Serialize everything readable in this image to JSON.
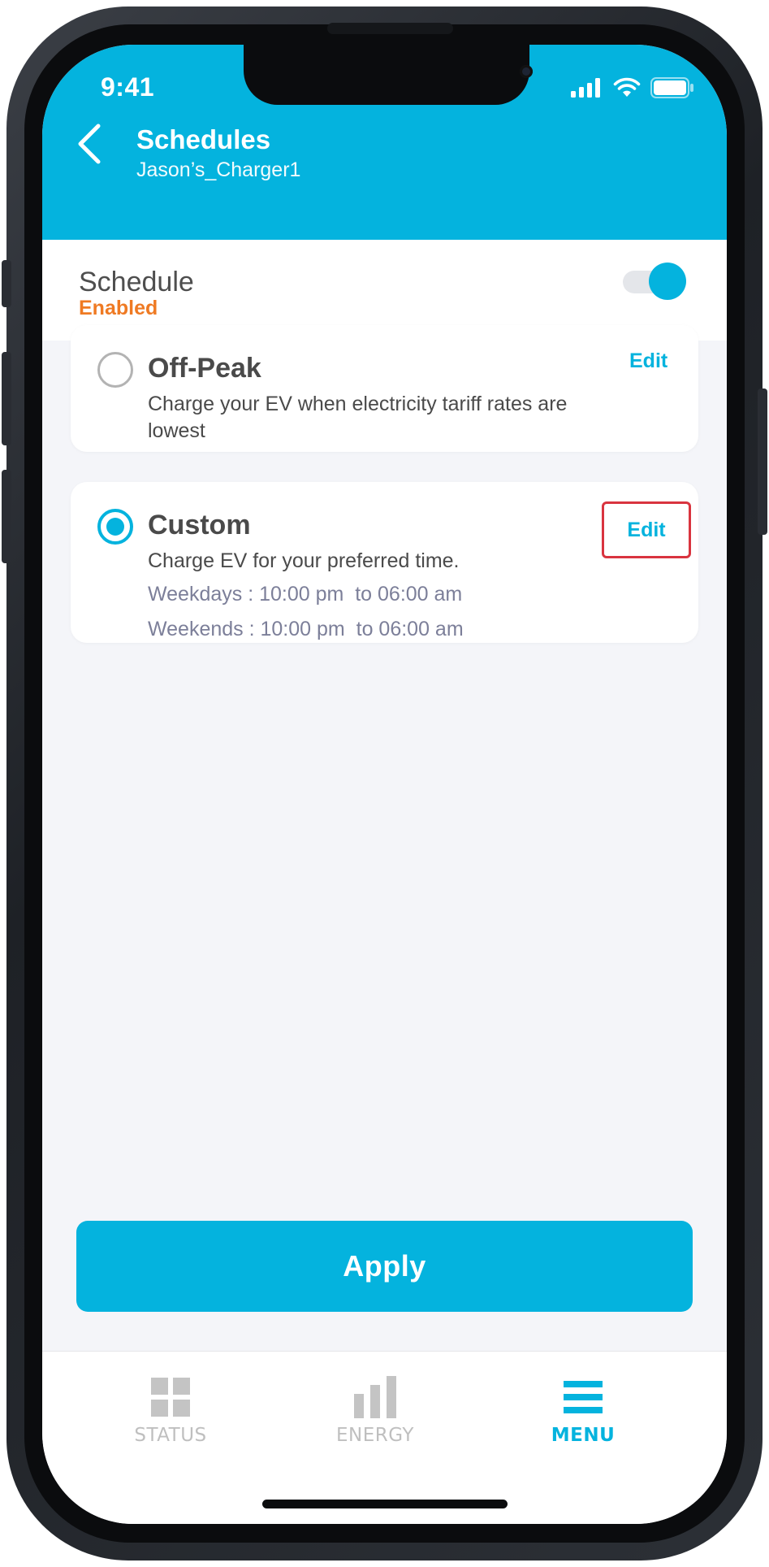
{
  "status_bar": {
    "time": "9:41",
    "icons": [
      "cellular-signal-icon",
      "wifi-icon",
      "battery-icon"
    ]
  },
  "header": {
    "title": "Schedules",
    "subtitle": "Jason’s_Charger1",
    "back_icon": "chevron-left-icon"
  },
  "schedule": {
    "label": "Schedule",
    "status": "Enabled",
    "toggle_on": true
  },
  "options": [
    {
      "title": "Off-Peak",
      "description": "Charge your EV when electricity tariff rates are lowest",
      "edit_label": "Edit",
      "selected": false
    },
    {
      "title": "Custom",
      "description": "Charge EV for your preferred time.",
      "weekdays": "Weekdays : 10:00 pm  to 06:00 am",
      "weekends": "Weekends : 10:00 pm  to 06:00 am",
      "edit_label": "Edit",
      "selected": true
    }
  ],
  "apply_label": "Apply",
  "tabs": [
    {
      "label": "STATUS",
      "icon": "grid-icon",
      "active": false
    },
    {
      "label": "ENERGY",
      "icon": "bar-chart-icon",
      "active": false
    },
    {
      "label": "MENU",
      "icon": "menu-icon",
      "active": true
    }
  ],
  "colors": {
    "primary": "#04b3de",
    "accent_status": "#ef7a23",
    "highlight_box": "#d9343f",
    "background": "#f4f5f9",
    "inactive_tab": "#bfbfbf"
  }
}
